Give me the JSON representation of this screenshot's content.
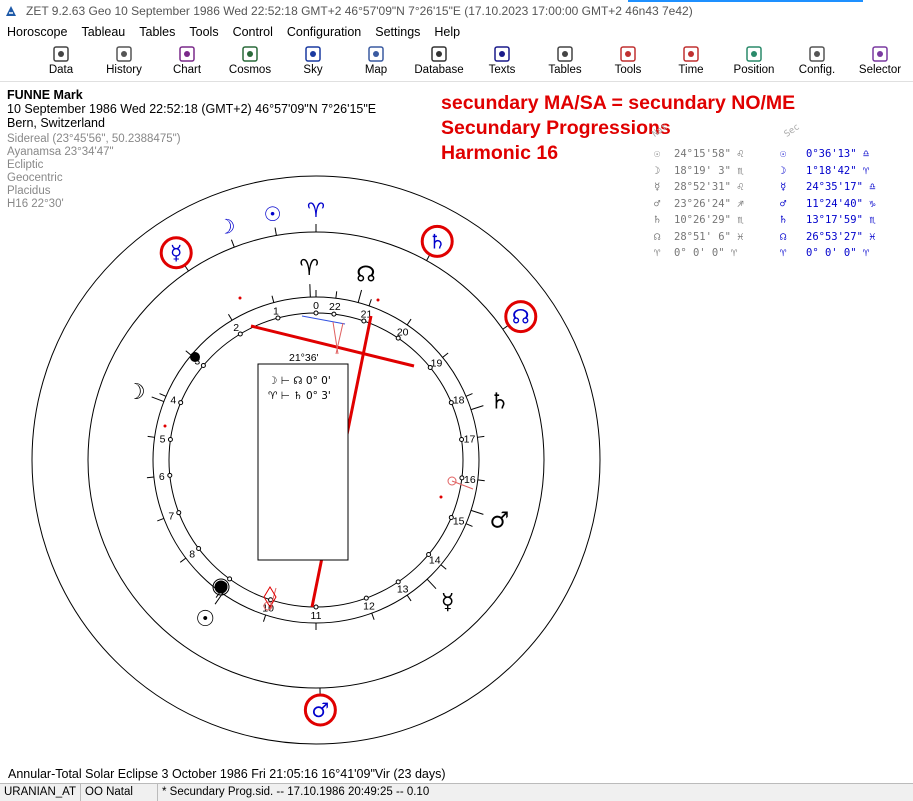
{
  "titlebar": {
    "title": "ZET 9.2.63 Geo    10 September 1986  Wed  22:52:18 GMT+2 46°57'09\"N  7°26'15\"E  (17.10.2023  17:00:00 GMT+2 46n43 7e42)"
  },
  "menu": [
    "Horoscope",
    "Tableau",
    "Tables",
    "Tools",
    "Control",
    "Configuration",
    "Settings",
    "Help"
  ],
  "toolbar": [
    {
      "label": "Data",
      "icon": "data-icon",
      "color": "#444"
    },
    {
      "label": "History",
      "icon": "history-icon",
      "color": "#555"
    },
    {
      "label": "Chart",
      "icon": "chart-icon",
      "color": "#7a2a8a"
    },
    {
      "label": "Cosmos",
      "icon": "cosmos-icon",
      "color": "#2a6a3a"
    },
    {
      "label": "Sky",
      "icon": "sky-icon",
      "color": "#1a3aa0"
    },
    {
      "label": "Map",
      "icon": "map-icon",
      "color": "#3a5aa0"
    },
    {
      "label": "Database",
      "icon": "database-icon",
      "color": "#333"
    },
    {
      "label": "Texts",
      "icon": "texts-icon",
      "color": "#1a1a8a"
    },
    {
      "label": "Tables",
      "icon": "tables-icon",
      "color": "#444"
    },
    {
      "label": "Tools",
      "icon": "tools-icon",
      "color": "#c03030"
    },
    {
      "label": "Time",
      "icon": "time-icon",
      "color": "#c03030"
    },
    {
      "label": "Position",
      "icon": "position-icon",
      "color": "#2a8a6a"
    },
    {
      "label": "Config.",
      "icon": "config-icon",
      "color": "#555"
    },
    {
      "label": "Selector",
      "icon": "selector-icon",
      "color": "#7a3aa0"
    }
  ],
  "person": {
    "name": "FUNNE Mark",
    "datetime": "10 September 1986  Wed  22:52:18 (GMT+2) 46°57'09\"N  7°26'15\"E",
    "place": "Bern, Switzerland",
    "settings": [
      "Sidereal (23°45'56\", 50.2388475\")",
      "Ayanamsa 23°34'47\"",
      "Ecliptic",
      "Geocentric",
      "Placidus",
      "H16  22°30'"
    ]
  },
  "annotation": [
    "secundary MA/SA = secundary NO/ME",
    "Secundary Progressions",
    "Harmonic 16"
  ],
  "positions": {
    "natal_header": "Nat",
    "secondary_header": "Sec",
    "rows": [
      {
        "nsym": "☉",
        "nval": "24°15'58\" ♌",
        "ssym": "☉",
        "sval": "0°36'13\" ♎"
      },
      {
        "nsym": "☽",
        "nval": "18°19' 3\" ♏",
        "ssym": "☽",
        "sval": "1°18'42\" ♈"
      },
      {
        "nsym": "☿",
        "nval": "28°52'31\" ♌",
        "ssym": "☿",
        "sval": "24°35'17\" ♎"
      },
      {
        "nsym": "♂",
        "nval": "23°26'24\" ♐",
        "ssym": "♂",
        "sval": "11°24'40\" ♑"
      },
      {
        "nsym": "♄",
        "nval": "10°26'29\" ♏",
        "ssym": "♄",
        "sval": "13°17'59\" ♏"
      },
      {
        "nsym": "☊",
        "nval": "28°51' 6\" ♓",
        "ssym": "☊",
        "sval": "26°53'27\" ♓"
      },
      {
        "nsym": "♈",
        "nval": "0° 0' 0\" ♈",
        "ssym": "♈",
        "sval": "0° 0' 0\" ♈"
      }
    ]
  },
  "chart": {
    "angle_label": "21°36'",
    "box_lines": [
      "☽ ⊢ ☊   0° 0'",
      "♈ ⊢ ♄   0° 3'"
    ],
    "house_numbers": [
      {
        "n": "0",
        "deg": 90
      },
      {
        "n": "1",
        "deg": 105
      },
      {
        "n": "2",
        "deg": 121
      },
      {
        "n": "3",
        "deg": 140
      },
      {
        "n": "4",
        "deg": 157
      },
      {
        "n": "5",
        "deg": 172
      },
      {
        "n": "6",
        "deg": 186
      },
      {
        "n": "7",
        "deg": 201
      },
      {
        "n": "8",
        "deg": 217
      },
      {
        "n": "9",
        "deg": 234
      },
      {
        "n": "10",
        "deg": 252
      },
      {
        "n": "11",
        "deg": 270
      },
      {
        "n": "12",
        "deg": 290
      },
      {
        "n": "13",
        "deg": 304
      },
      {
        "n": "14",
        "deg": 320
      },
      {
        "n": "15",
        "deg": 337
      },
      {
        "n": "16",
        "deg": 353
      },
      {
        "n": "17",
        "deg": 8
      },
      {
        "n": "18",
        "deg": 23
      },
      {
        "n": "19",
        "deg": 39
      },
      {
        "n": "20",
        "deg": 56
      },
      {
        "n": "21",
        "deg": 71
      },
      {
        "n": "22",
        "deg": 83
      }
    ],
    "inner_glyphs": [
      {
        "g": "♈",
        "deg": 92,
        "name": "aries-icon",
        "color": "#000"
      },
      {
        "g": "☊",
        "deg": 75,
        "name": "north-node-icon",
        "color": "#000"
      },
      {
        "g": "♄",
        "deg": 18,
        "name": "saturn-icon",
        "color": "#000"
      },
      {
        "g": "♂",
        "deg": 342,
        "name": "mars-icon",
        "color": "#000"
      },
      {
        "g": "☿",
        "deg": 313,
        "name": "mercury-icon",
        "color": "#000"
      },
      {
        "g": "☉",
        "deg": 235,
        "name": "sun-icon",
        "color": "#000"
      },
      {
        "g": "☽",
        "deg": 159,
        "name": "moon-icon",
        "color": "#000"
      }
    ],
    "outer_glyphs": [
      {
        "g": "♈",
        "deg": 90,
        "name": "aries-icon",
        "color": "#0000cc",
        "circled": false
      },
      {
        "g": "☉",
        "deg": 100,
        "name": "sun-icon",
        "color": "#0000cc",
        "circled": false
      },
      {
        "g": "☽",
        "deg": 111,
        "name": "moon-icon",
        "color": "#0000cc",
        "circled": false
      },
      {
        "g": "☿",
        "deg": 124,
        "name": "mercury-icon",
        "color": "#0000cc",
        "circled": true
      },
      {
        "g": "♄",
        "deg": 61,
        "name": "saturn-icon",
        "color": "#0000cc",
        "circled": true
      },
      {
        "g": "☊",
        "deg": 35,
        "name": "north-node-icon",
        "color": "#0000cc",
        "circled": true
      },
      {
        "g": "♂",
        "deg": 271,
        "name": "mars-icon",
        "color": "#0000cc",
        "circled": true
      }
    ]
  },
  "eclipse_line": "Annular-Total Solar Eclipse 3 October 1986 Fri 21:05:16 16°41'09\"Vir (23 days)",
  "statusbar": [
    "URANIAN_AT",
    "OO Natal",
    "*  Secundary Prog.sid. -- 17.10.1986 20:49:25 -- 0.10"
  ],
  "colors": {
    "accent_red": "#e00000",
    "secondary_blue": "#0000cc"
  }
}
